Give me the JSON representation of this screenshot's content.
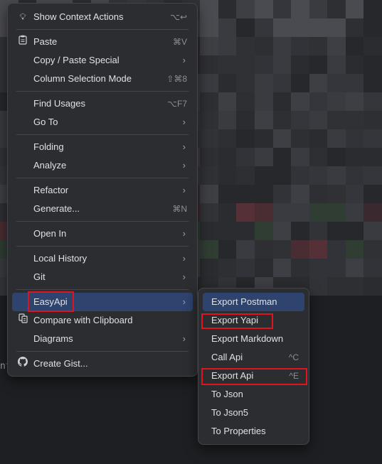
{
  "background_text": "nt",
  "main_menu": {
    "items": [
      {
        "label": "Show Context Actions",
        "shortcut": "⌥↩",
        "icon": "lightbulb-icon"
      },
      {
        "label": "Paste",
        "shortcut": "⌘V",
        "icon": "clipboard-icon"
      },
      {
        "label": "Copy / Paste Special",
        "submenu": true
      },
      {
        "label": "Column Selection Mode",
        "shortcut": "⇧⌘8"
      },
      {
        "label": "Find Usages",
        "shortcut": "⌥F7"
      },
      {
        "label": "Go To",
        "submenu": true
      },
      {
        "label": "Folding",
        "submenu": true
      },
      {
        "label": "Analyze",
        "submenu": true
      },
      {
        "label": "Refactor",
        "submenu": true
      },
      {
        "label": "Generate...",
        "shortcut": "⌘N"
      },
      {
        "label": "Open In",
        "submenu": true
      },
      {
        "label": "Local History",
        "submenu": true
      },
      {
        "label": "Git",
        "submenu": true
      },
      {
        "label": "EasyApi",
        "submenu": true,
        "active": true,
        "highlighted": true
      },
      {
        "label": "Compare with Clipboard",
        "icon": "compare-icon"
      },
      {
        "label": "Diagrams",
        "submenu": true
      },
      {
        "label": "Create Gist...",
        "icon": "github-icon"
      }
    ],
    "arrow_glyph": "›"
  },
  "sub_menu": {
    "items": [
      {
        "label": "Export Postman",
        "active": true
      },
      {
        "label": "Export Yapi",
        "highlighted": true
      },
      {
        "label": "Export Markdown"
      },
      {
        "label": "Call Api",
        "shortcut": "^C"
      },
      {
        "label": "Export Api",
        "shortcut": "^E",
        "highlighted": true
      },
      {
        "label": "To Json"
      },
      {
        "label": "To Json5"
      },
      {
        "label": "To Properties"
      }
    ]
  },
  "colors": {
    "menu_bg": "#2b2d30",
    "active_bg": "#2e436e",
    "highlight_box": "#e0141e",
    "text": "#dfe1e5"
  }
}
